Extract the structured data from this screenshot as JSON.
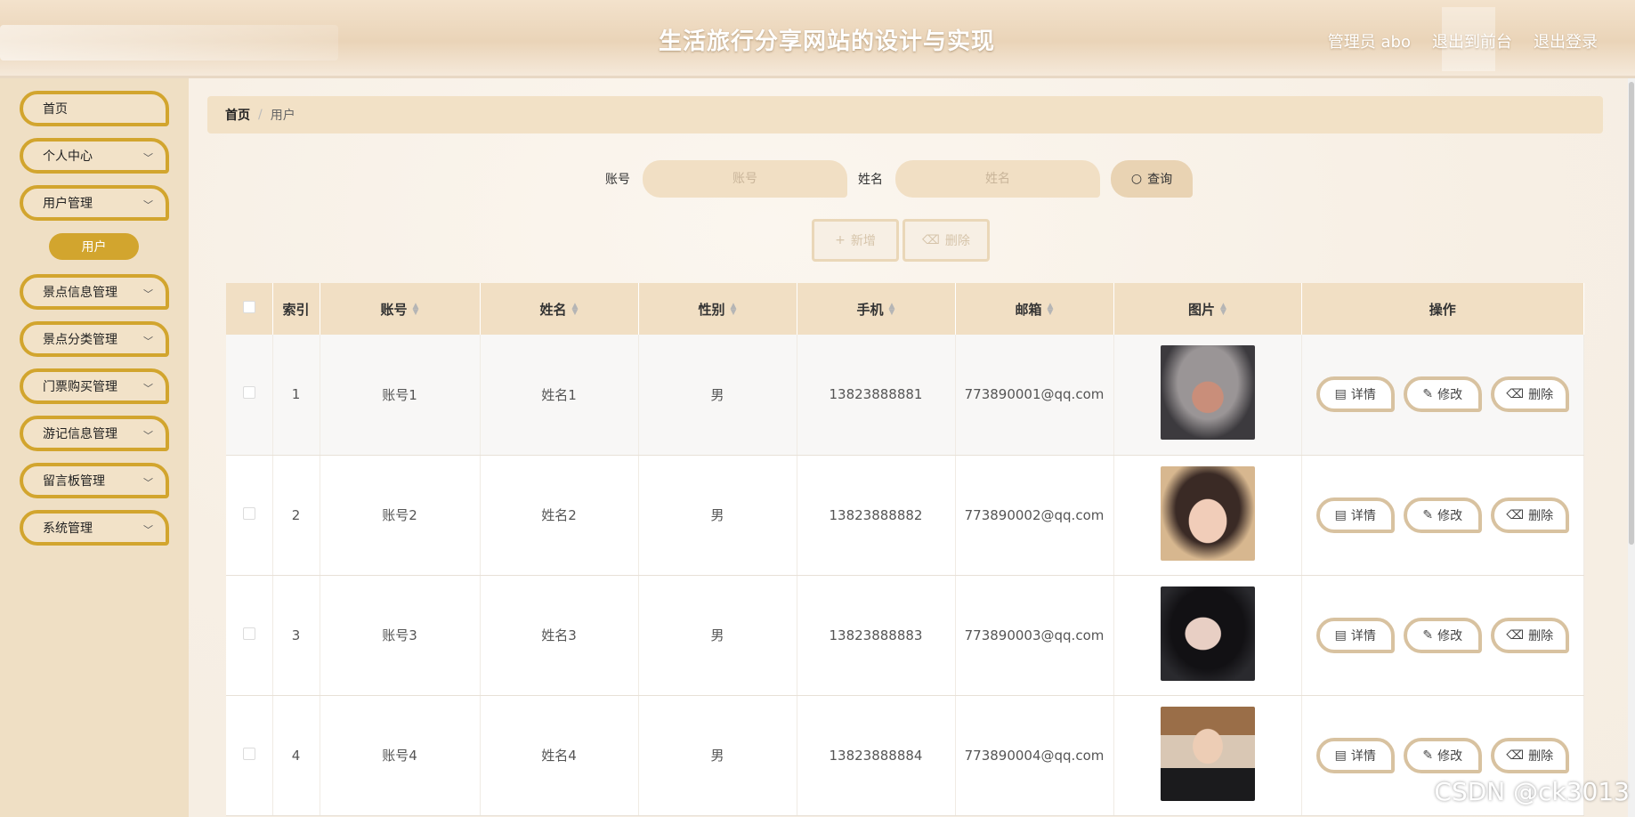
{
  "header": {
    "title": "生活旅行分享网站的设计与实现",
    "admin": "管理员 abo",
    "back_front": "退出到前台",
    "logout": "退出登录"
  },
  "sidebar": {
    "items": [
      {
        "label": "首页"
      },
      {
        "label": "个人中心"
      },
      {
        "label": "用户管理"
      },
      {
        "label": "景点信息管理"
      },
      {
        "label": "景点分类管理"
      },
      {
        "label": "门票购买管理"
      },
      {
        "label": "游记信息管理"
      },
      {
        "label": "留言板管理"
      },
      {
        "label": "系统管理"
      }
    ],
    "sub_active": "用户"
  },
  "breadcrumb": {
    "home": "首页",
    "sep": "/",
    "current": "用户"
  },
  "search": {
    "account_label": "账号",
    "account_placeholder": "账号",
    "name_label": "姓名",
    "name_placeholder": "姓名",
    "query_label": "查询"
  },
  "actions": {
    "add_label": "新增",
    "delete_label": "删除"
  },
  "table": {
    "headers": [
      "索引",
      "账号",
      "姓名",
      "性别",
      "手机",
      "邮箱",
      "图片",
      "操作"
    ],
    "rows": [
      {
        "index": "1",
        "account": "账号1",
        "name": "姓名1",
        "gender": "男",
        "phone": "13823888881",
        "email": "773890001@qq.com"
      },
      {
        "index": "2",
        "account": "账号2",
        "name": "姓名2",
        "gender": "男",
        "phone": "13823888882",
        "email": "773890002@qq.com"
      },
      {
        "index": "3",
        "account": "账号3",
        "name": "姓名3",
        "gender": "男",
        "phone": "13823888883",
        "email": "773890003@qq.com"
      },
      {
        "index": "4",
        "account": "账号4",
        "name": "姓名4",
        "gender": "男",
        "phone": "13823888884",
        "email": "773890004@qq.com"
      }
    ],
    "op_detail": "详情",
    "op_edit": "修改",
    "op_delete": "删除"
  },
  "watermark": "CSDN @ck3013",
  "colors": {
    "accent": "#d2a52e",
    "header_bg": "#f1dfc4",
    "sidebar_bg": "#efdfc4"
  }
}
